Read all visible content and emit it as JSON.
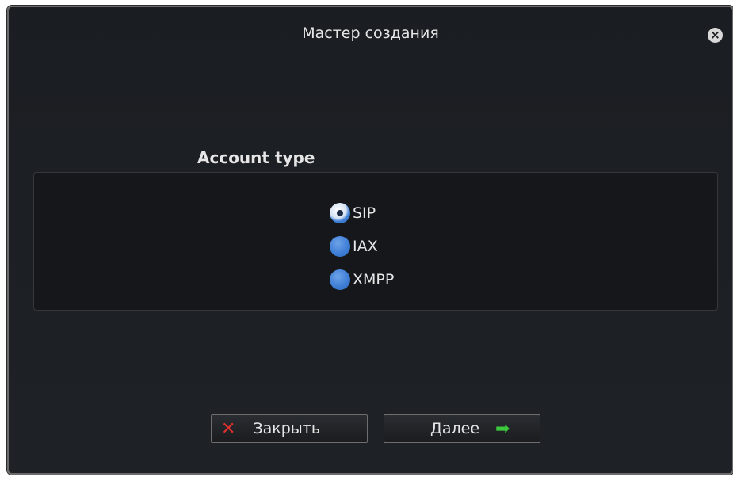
{
  "dialog": {
    "title": "Мастер создания",
    "close_icon": "⊗"
  },
  "account_type": {
    "label": "Account type",
    "options": [
      {
        "label": "SIP",
        "checked": true
      },
      {
        "label": "IAX",
        "checked": false
      },
      {
        "label": "XMPP",
        "checked": false
      }
    ]
  },
  "buttons": {
    "close_label": "Закрыть",
    "close_icon": "✕",
    "next_label": "Далее",
    "next_icon": "➡"
  },
  "colors": {
    "background": "#1b1e22",
    "accent_blue": "#3f7fd6",
    "close_red": "#e23030",
    "next_green": "#3cc83c"
  }
}
